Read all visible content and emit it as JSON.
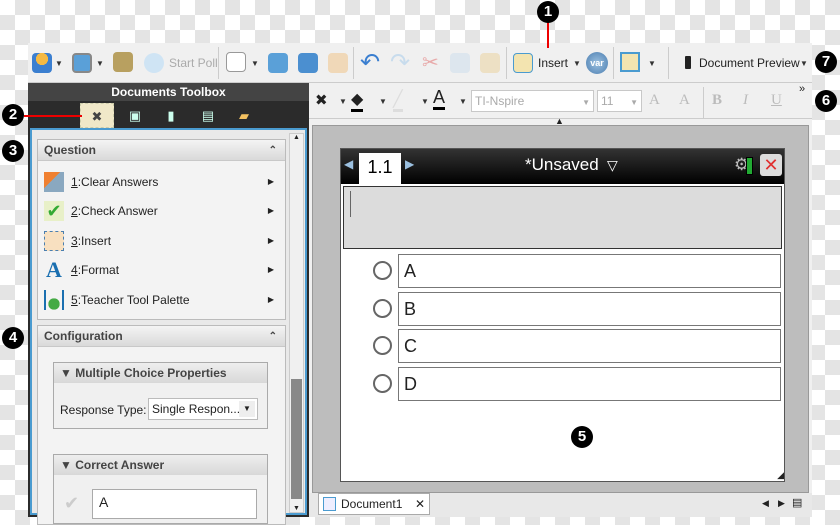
{
  "callouts": [
    "1",
    "2",
    "3",
    "4",
    "5",
    "6",
    "7"
  ],
  "toolbar": {
    "start_poll": "Start Poll",
    "insert": "Insert",
    "var": "var",
    "document_preview": "Document Preview"
  },
  "toolbox": {
    "title": "Documents Toolbox",
    "tabs": [
      "tools",
      "page-sorter",
      "scratchpad",
      "utilities",
      "content"
    ],
    "question": {
      "title": "Question",
      "items": [
        {
          "num": "1",
          "label": ":Clear Answers",
          "icon": "clear-answers-icon"
        },
        {
          "num": "2",
          "label": ":Check Answer",
          "icon": "check-answer-icon"
        },
        {
          "num": "3",
          "label": ":Insert",
          "icon": "insert-icon"
        },
        {
          "num": "4",
          "label": ":Format",
          "icon": "format-icon"
        },
        {
          "num": "5",
          "label": ":Teacher Tool Palette",
          "icon": "teacher-tool-palette-icon"
        }
      ]
    },
    "configuration": {
      "title": "Configuration",
      "mc_properties": {
        "title": "Multiple Choice Properties",
        "response_type_label": "Response Type:",
        "response_type_value": "Single Respon..."
      },
      "correct_answer": {
        "title": "Correct Answer",
        "value": "A"
      }
    }
  },
  "format": {
    "font": "TI-Nspire",
    "size": "11",
    "bold": "B",
    "italic": "I",
    "underline": "U",
    "grow": "A",
    "shrink": "A",
    "more": "»"
  },
  "document": {
    "page_tab": "1.1",
    "title": "*Unsaved",
    "options": [
      "A",
      "B",
      "C",
      "D"
    ],
    "tab": "Document1",
    "close": "✕"
  },
  "colors": {
    "accent": "#4a9bd0",
    "callout_line": "#e00000",
    "battery": "#22aa33",
    "close": "#e03030"
  }
}
